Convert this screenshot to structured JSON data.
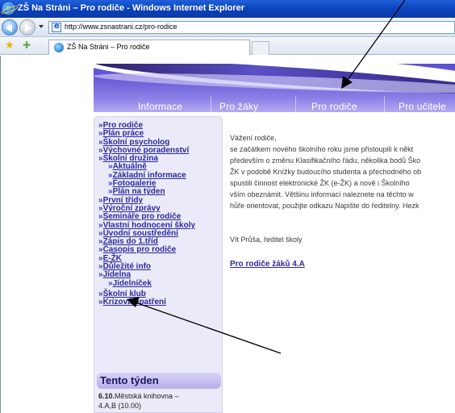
{
  "window": {
    "title": "ZŠ Na Stráni – Pro rodiče - Windows Internet Explorer"
  },
  "address_bar": {
    "url": "http://www.zsnastrani.cz/pro-rodice"
  },
  "tab": {
    "label": "ZŠ Na Stráni – Pro rodiče"
  },
  "icons": {
    "browser_logo": "ie-logo-icon",
    "back": "back-arrow-icon",
    "forward": "forward-arrow-icon",
    "favorites": "favorites-star-icon",
    "add_favorite": "add-favorite-icon",
    "page": "page-icon"
  },
  "nav": {
    "tabs": [
      "Informace",
      "Pro žáky",
      "Pro rodiče",
      "Pro učitele"
    ]
  },
  "sidebar": {
    "mark": "»",
    "items": [
      {
        "label": "Pro rodiče",
        "sub": false
      },
      {
        "label": "Plán práce",
        "sub": false
      },
      {
        "label": "Školní psycholog",
        "sub": false
      },
      {
        "label": "Výchovné poradenství",
        "sub": false
      },
      {
        "label": "Školní družina",
        "sub": false
      },
      {
        "label": "Aktuálně",
        "sub": true
      },
      {
        "label": "Základní informace",
        "sub": true
      },
      {
        "label": "Fotogalerie",
        "sub": true
      },
      {
        "label": "Plán na týden",
        "sub": true
      },
      {
        "label": "První třídy",
        "sub": false
      },
      {
        "label": "Výroční zprávy",
        "sub": false
      },
      {
        "label": "Semináře pro rodiče",
        "sub": false
      },
      {
        "label": "Vlastní hodnocení školy",
        "sub": false
      },
      {
        "label": "Úvodní soustředění",
        "sub": false
      },
      {
        "label": "Zápis do 1.tříd",
        "sub": false
      },
      {
        "label": "Časopis pro rodiče",
        "sub": false
      },
      {
        "label": "E-ŽK",
        "sub": false
      },
      {
        "label": "Důležité info",
        "sub": false
      },
      {
        "label": "Jídelna",
        "sub": false
      },
      {
        "label": "Jídelníček",
        "sub": true
      },
      {
        "label": "Školní klub",
        "sub": false
      },
      {
        "label": "Krizová opatření",
        "sub": false
      }
    ],
    "week": {
      "title": "Tento týden",
      "date": "6.10.",
      "event": "Městská knihovna –",
      "detail": "4.A,B (10.00)"
    }
  },
  "content": {
    "greeting": "Vážení rodiče,",
    "lines": [
      "se začátkem nového školního roku jsme přistoupili k někt",
      "především o změnu Klasifikačního řádu, několika bodů Ško",
      "ŽK v podobě Knížky budoucího studenta a přechodného ob",
      "spustili činnost elektronické ŽK (e-ŽK) a nově i Školního",
      "vším obeznámit. Většinu informací naleznete na těchto w",
      "hůře orientovat, použijte odkazu Napište do ředitelny. Hezk"
    ],
    "signature": "Vít Průša, ředitel školy",
    "link": "Pro rodiče žáků 4.A"
  }
}
